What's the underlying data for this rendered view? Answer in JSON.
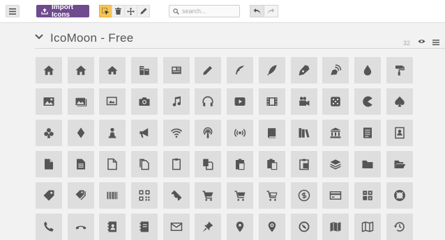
{
  "toolbar": {
    "import_label": "Import Icons",
    "search_placeholder": "search...",
    "accent_color": "#6f4a8e",
    "select_tool_color": "#f6c556",
    "tools": [
      "select-icon",
      "trash-icon",
      "move-icon",
      "pencil-icon"
    ],
    "history": [
      "undo-icon",
      "redo-icon"
    ]
  },
  "icon_set": {
    "title": "IcoMoon - Free",
    "count": "32",
    "icons": [
      [
        "home",
        "home2",
        "home3",
        "office",
        "newspaper",
        "pencil",
        "quill",
        "quill2",
        "pen",
        "blog",
        "droplet",
        "paint-format"
      ],
      [
        "image",
        "images",
        "images2",
        "camera",
        "music",
        "headphones",
        "play",
        "film",
        "video-camera",
        "dice",
        "pacman",
        "spades"
      ],
      [
        "clubs",
        "diamonds",
        "pawn",
        "bullhorn",
        "connection",
        "podcast",
        "feed",
        "book",
        "books",
        "library",
        "file-text",
        "profile"
      ],
      [
        "file-empty",
        "file-text2",
        "file-picture",
        "files-empty",
        "file-music",
        "copy",
        "paste",
        "paste2",
        "paste3",
        "stack",
        "folder",
        "folder-open"
      ],
      [
        "price-tag",
        "price-tags",
        "barcode",
        "qrcode",
        "ticket",
        "cart",
        "cart2",
        "cart3",
        "coin-dollar",
        "credit-card",
        "calculator",
        "lifebuoy"
      ],
      [
        "phone",
        "phone-hang-up",
        "address-book",
        "notebook",
        "envelop",
        "pushpin",
        "location",
        "location2",
        "compass",
        "map",
        "map2",
        "history"
      ]
    ]
  }
}
